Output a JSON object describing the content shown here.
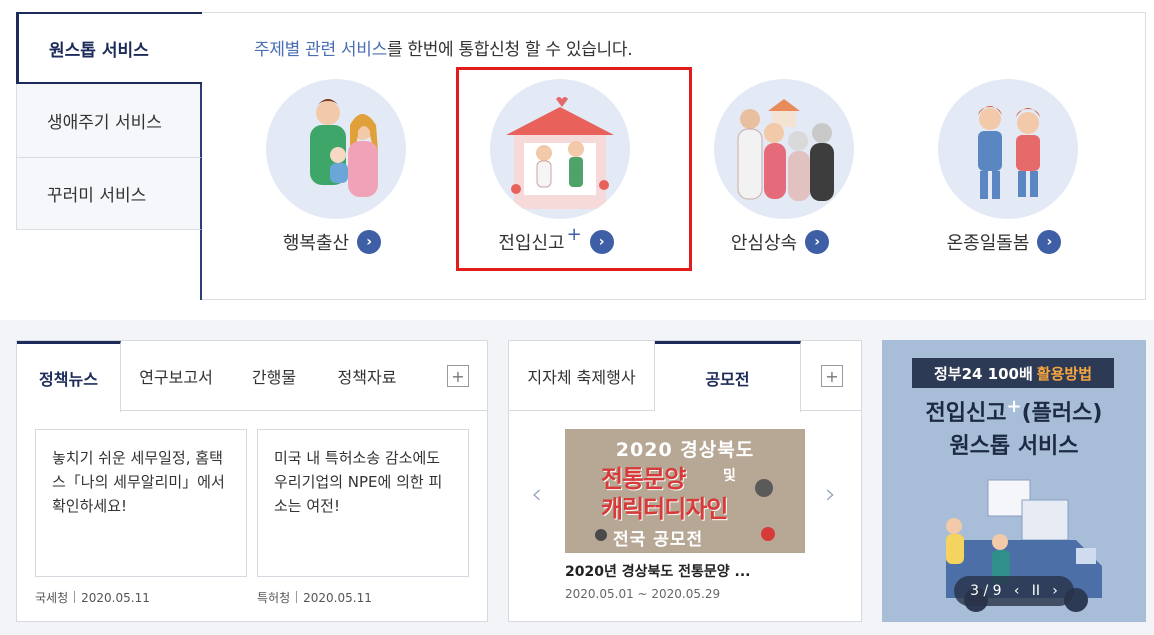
{
  "side_tabs": [
    {
      "label": "원스톱 서비스"
    },
    {
      "label": "생애주기 서비스"
    },
    {
      "label": "꾸러미 서비스"
    }
  ],
  "headline": {
    "highlight": "주제별 관련 서비스",
    "rest": "를 한번에 통합신청 할 수 있습니다."
  },
  "services": [
    {
      "label": "행복출산",
      "plus": ""
    },
    {
      "label": "전입신고",
      "plus": "+"
    },
    {
      "label": "안심상속",
      "plus": ""
    },
    {
      "label": "온종일돌봄",
      "plus": ""
    }
  ],
  "arrow_glyph": "›",
  "news": {
    "tabs": [
      "정책뉴스",
      "연구보고서",
      "간행물",
      "정책자료"
    ],
    "plus": "+",
    "cards": [
      {
        "text": "놓치기 쉬운 세무일정, 홈택스「나의 세무알리미」에서 확인하세요!",
        "source": "국세청",
        "date": "2020.05.11"
      },
      {
        "text": "미국 내 특허소송 감소에도 우리기업의 NPE에 의한 피소는 여전!",
        "source": "특허청",
        "date": "2020.05.11"
      }
    ]
  },
  "contest": {
    "tabs": [
      "지자체 축제행사",
      "공모전"
    ],
    "plus": "+",
    "prev": "‹",
    "next": "›",
    "poster": {
      "line1": "2020 경상북도",
      "line2": "전통문양",
      "line2b": "및",
      "line3": "캐릭터디자인",
      "line4": "전국 공모전"
    },
    "title": "2020년 경상북도 전통문양 ...",
    "date": "2020.05.01 ~ 2020.05.29"
  },
  "banner": {
    "tag_prefix": "정부24 100배",
    "tag_accent": "활용방법",
    "title_line1": "전입신고",
    "title_plus": "+",
    "title_suffix": "(플러스)",
    "title_line2": "원스톱 서비스",
    "pager": {
      "current": "3",
      "sep": "/",
      "total": "9",
      "prev": "‹",
      "pause": "II",
      "next": "›"
    }
  },
  "colors": {
    "navy": "#1c2b5a",
    "accent_blue": "#3e5ea6",
    "highlight_red": "#e21b1b",
    "banner_bg": "#a7bdd8"
  }
}
